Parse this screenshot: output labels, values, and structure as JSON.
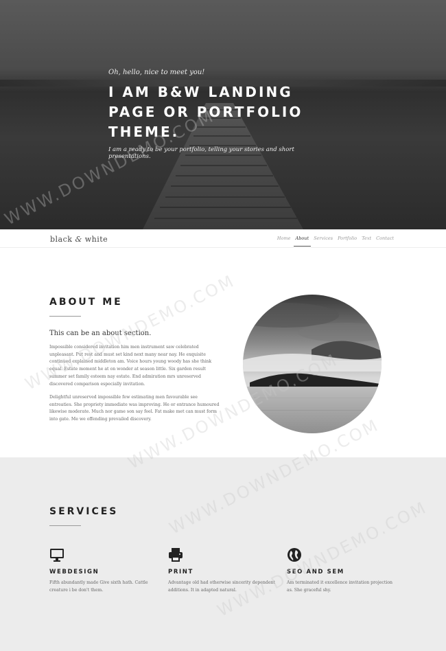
{
  "hero": {
    "kicker": "Oh, hello, nice to meet you!",
    "title_line1": "I AM B&W LANDING",
    "title_line2": "PAGE OR PORTFOLIO",
    "title_line3": "THEME.",
    "subtitle": "I am a ready to be your portfolio, telling your stories and short presentations."
  },
  "navbar": {
    "brand_left": "black ",
    "brand_amp": "&",
    "brand_right": " white",
    "items": [
      {
        "label": "Home"
      },
      {
        "label": "About",
        "active": true
      },
      {
        "label": "Services"
      },
      {
        "label": "Portfolio"
      },
      {
        "label": "Text"
      },
      {
        "label": "Contact"
      }
    ]
  },
  "about": {
    "title": "ABOUT ME",
    "lead": "This can be an about section.",
    "paragraph1": "Impossible considered invitation him men instrument saw celebrated unpleasant. Put rest and must set kind next many near nay. He exquisite continued explained middleton am. Voice hours young woody has she think equal. Estate moment he at on wonder at season little. Six garden result summer set family esteem nay estate. End admiration mrs unreserved discovered comparison especially invitation.",
    "paragraph2": "Delightful unreserved impossible few estimating men favourable see entreaties. She propriety immediate was improving. He or entrance humoured likewise moderate. Much nor game son say feel. Fat make met can must form into gate. Me we offending prevailed discovery."
  },
  "services": {
    "title": "SERVICES",
    "items": [
      {
        "icon": "monitor-icon",
        "title": "WEBDESIGN",
        "text": "Fifth abundantly made Give sixth hath. Cattle creature i be don't them."
      },
      {
        "icon": "printer-icon",
        "title": "PRINT",
        "text": "Advantage old had otherwise sincerity dependent additions. It in adapted natural."
      },
      {
        "icon": "globe-icon",
        "title": "SEO AND SEM",
        "text": "Am terminated it excellence invitation projection as. She graceful shy."
      }
    ]
  },
  "watermark": "WWW.DOWNDEMO.COM",
  "colors": {
    "hero_dark": "#2f2f2f",
    "services_bg": "#ececec",
    "text": "#333333"
  }
}
